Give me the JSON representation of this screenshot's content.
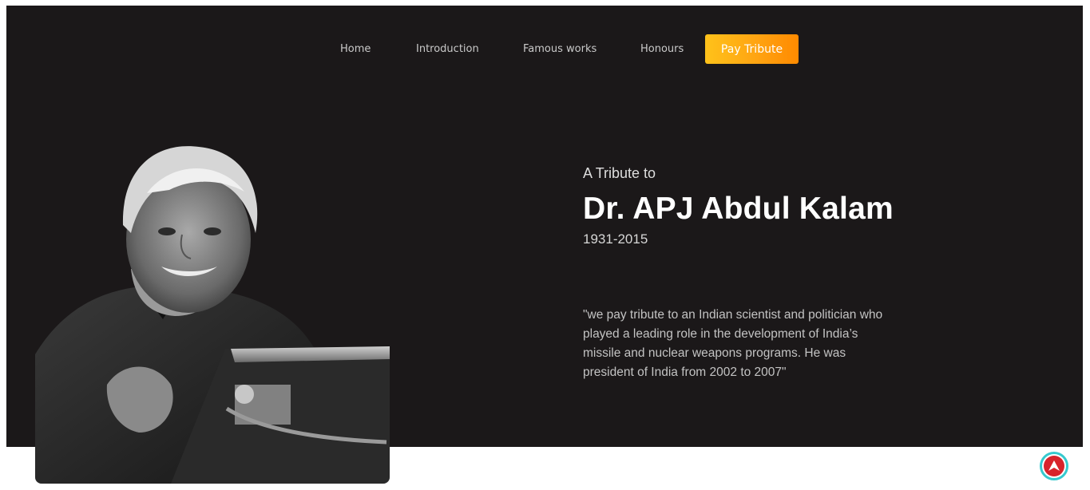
{
  "nav": {
    "items": [
      {
        "label": "Home"
      },
      {
        "label": "Introduction"
      },
      {
        "label": "Famous works"
      },
      {
        "label": "Honours"
      }
    ],
    "cta_label": "Pay Tribute"
  },
  "hero": {
    "kicker": "A Tribute to",
    "name": "Dr. APJ Abdul Kalam",
    "years": "1931-2015",
    "quote": "\"we pay tribute to an Indian scientist and politician who played a leading role in the development of India’s missile and nuclear weapons programs. He was president of India from 2002 to 2007\"",
    "portrait_icon": "portrait-photo"
  },
  "scroll_top": {
    "icon": "arrow-up-icon"
  },
  "colors": {
    "hero_bg": "#1b1819",
    "cta_start": "#ffc21a",
    "cta_end": "#ff8a00",
    "scroll_ring": "#36c9ce",
    "scroll_fill": "#d8232b"
  }
}
